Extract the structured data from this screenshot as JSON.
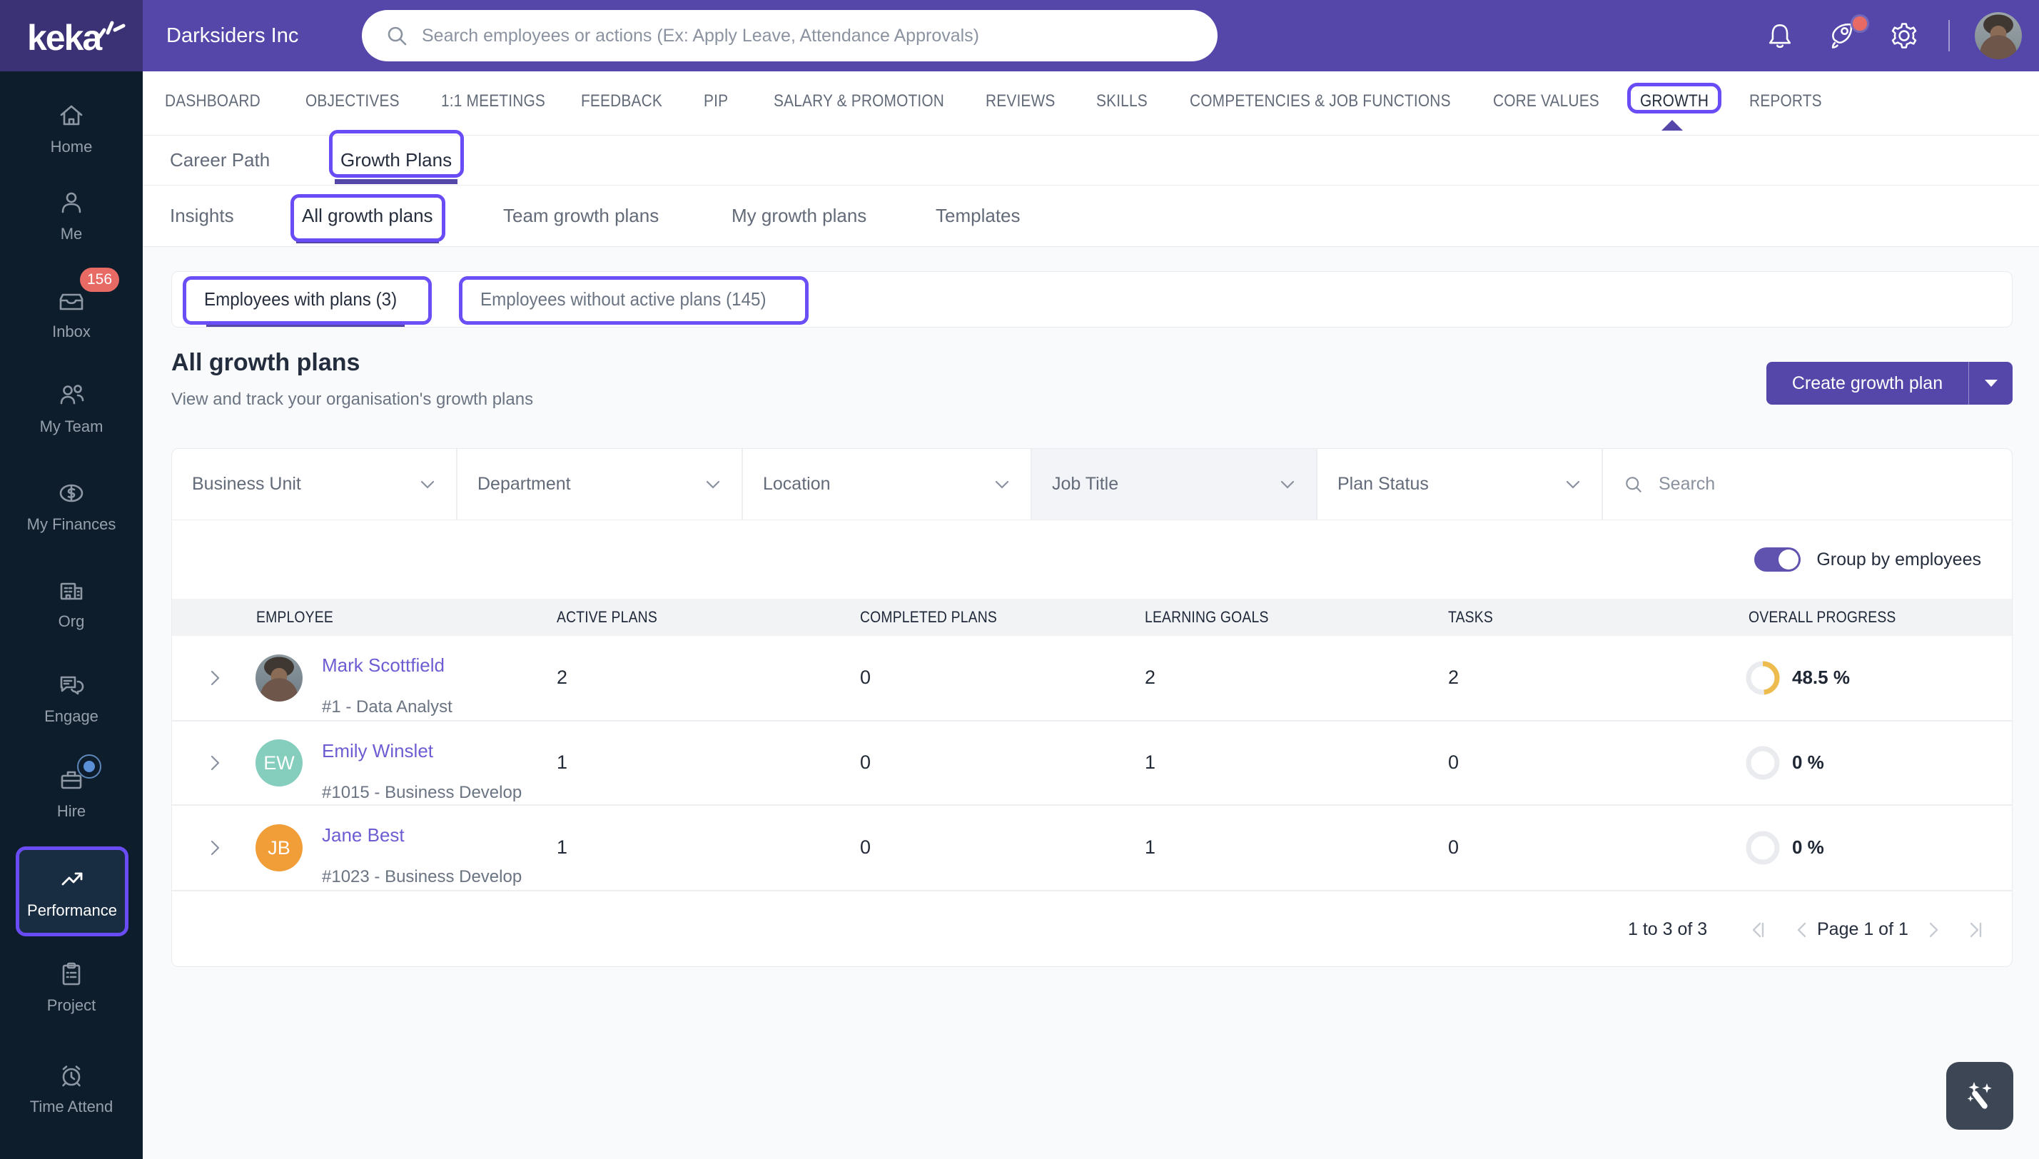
{
  "topbar": {
    "logo_text": "keka",
    "company": "Darksiders Inc",
    "search_placeholder": "Search employees or actions (Ex: Apply Leave, Attendance Approvals)"
  },
  "sidebar": {
    "items": [
      {
        "id": "home",
        "label": "Home"
      },
      {
        "id": "me",
        "label": "Me"
      },
      {
        "id": "inbox",
        "label": "Inbox",
        "badge": "156"
      },
      {
        "id": "my-team",
        "label": "My Team"
      },
      {
        "id": "my-finances",
        "label": "My Finances"
      },
      {
        "id": "org",
        "label": "Org"
      },
      {
        "id": "engage",
        "label": "Engage"
      },
      {
        "id": "hire",
        "label": "Hire",
        "dot": true
      },
      {
        "id": "performance",
        "label": "Performance",
        "active": true
      },
      {
        "id": "project",
        "label": "Project"
      },
      {
        "id": "time-attend",
        "label": "Time Attend"
      }
    ]
  },
  "nav": {
    "tabs": [
      "DASHBOARD",
      "OBJECTIVES",
      "1:1 MEETINGS",
      "FEEDBACK",
      "PIP",
      "SALARY & PROMOTION",
      "REVIEWS",
      "SKILLS",
      "COMPETENCIES & JOB FUNCTIONS",
      "CORE VALUES",
      "GROWTH",
      "REPORTS"
    ],
    "active": "GROWTH"
  },
  "subnav": {
    "items": [
      "Career Path",
      "Growth Plans"
    ],
    "active": "Growth Plans"
  },
  "sections": {
    "items": [
      "Insights",
      "All growth plans",
      "Team growth plans",
      "My growth plans",
      "Templates"
    ],
    "active": "All growth plans"
  },
  "chips": {
    "items": [
      "Employees with plans (3)",
      "Employees without active plans (145)"
    ],
    "active": "Employees with plans (3)"
  },
  "page": {
    "title": "All growth plans",
    "subtitle": "View and track your organisation's growth plans",
    "create_button": "Create growth plan"
  },
  "filters": {
    "dropdowns": [
      "Business Unit",
      "Department",
      "Location",
      "Job Title",
      "Plan Status"
    ],
    "highlighted": "Job Title",
    "search_placeholder": "Search"
  },
  "toolbar": {
    "group_toggle_label": "Group by employees",
    "group_toggle_on": true
  },
  "table": {
    "columns": [
      "EMPLOYEE",
      "ACTIVE PLANS",
      "COMPLETED PLANS",
      "LEARNING GOALS",
      "TASKS",
      "OVERALL PROGRESS"
    ],
    "rows": [
      {
        "name": "Mark Scottfield",
        "detail": "#1 - Data Analyst",
        "avatar_type": "photo",
        "initials": "",
        "avatar_color": "",
        "active_plans": "2",
        "completed_plans": "0",
        "learning_goals": "2",
        "tasks": "2",
        "progress_pct": 48.5,
        "progress_label": "48.5 %"
      },
      {
        "name": "Emily Winslet",
        "detail": "#1015 - Business Develop",
        "avatar_type": "initials",
        "initials": "EW",
        "avatar_color": "#85cdbc",
        "active_plans": "1",
        "completed_plans": "0",
        "learning_goals": "1",
        "tasks": "0",
        "progress_pct": 0,
        "progress_label": "0 %"
      },
      {
        "name": "Jane Best",
        "detail": "#1023 - Business Develop",
        "avatar_type": "initials",
        "initials": "JB",
        "avatar_color": "#f19d38",
        "active_plans": "1",
        "completed_plans": "0",
        "learning_goals": "1",
        "tasks": "0",
        "progress_pct": 0,
        "progress_label": "0 %"
      }
    ]
  },
  "pagination": {
    "range": "1 to 3 of 3",
    "page": "Page 1 of 1"
  },
  "colors": {
    "accent": "#5547a9",
    "annotation": "#694cf6",
    "badge": "#e86a65",
    "progress_gold": "#eebc4e",
    "sidebar_bg": "#0e1d2b",
    "page_bg": "#f9fafb"
  }
}
